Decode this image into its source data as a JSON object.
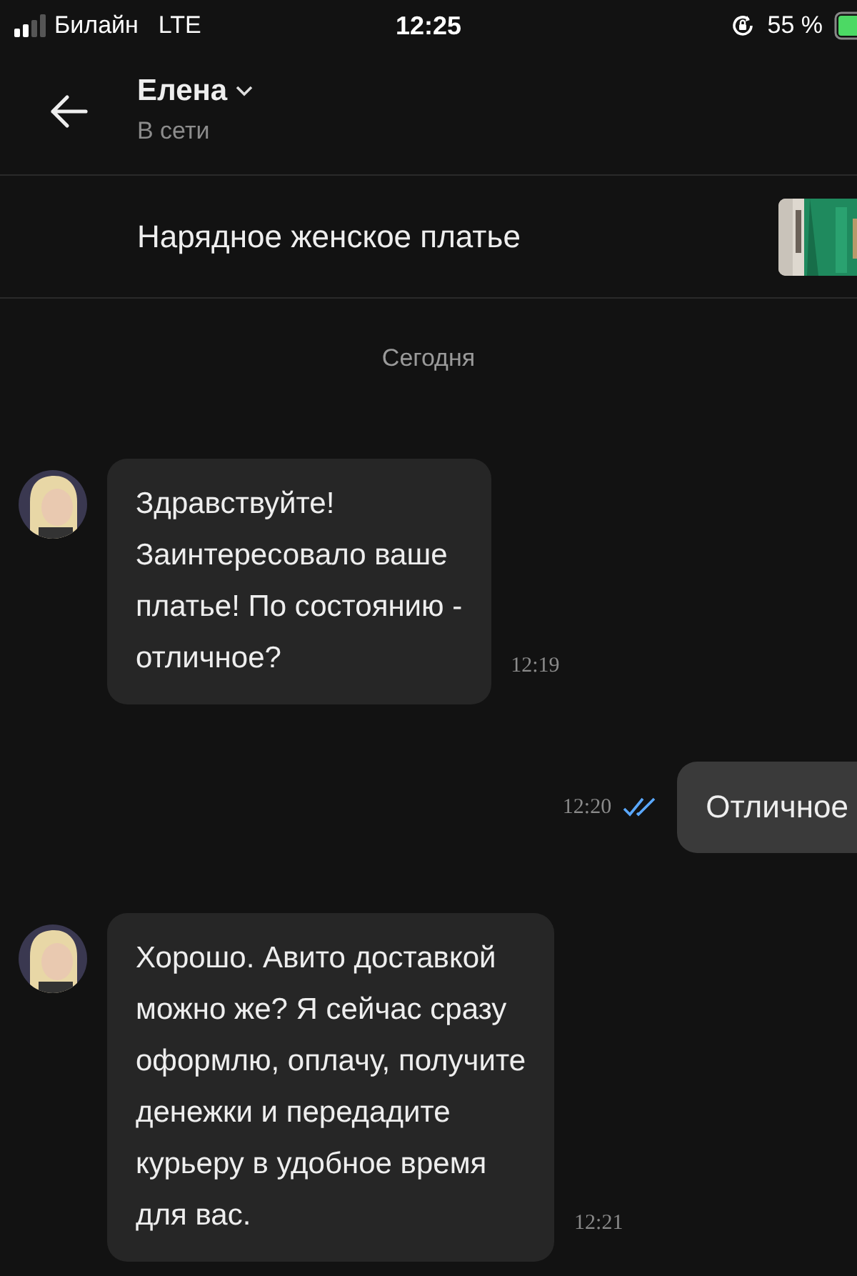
{
  "status_bar": {
    "carrier": "Билайн",
    "network": "LTE",
    "time": "12:25",
    "battery": "55 %"
  },
  "header": {
    "name": "Елена",
    "presence": "В сети"
  },
  "listing": {
    "title": "Нарядное женское платье"
  },
  "date_divider": "Сегодня",
  "messages": [
    {
      "kind": "incoming",
      "lines": [
        "Здравствуйте!",
        "Заинтересовало ваше",
        "платье! По состоянию -",
        "отличное?"
      ],
      "time": "12:19"
    },
    {
      "kind": "outgoing",
      "lines": [
        "Отличное"
      ],
      "time": "12:20",
      "read": true
    },
    {
      "kind": "incoming",
      "lines": [
        "Хорошо. Авито доставкой",
        "можно же? Я сейчас сразу",
        "оформлю, оплачу, получите",
        "денежки и передадите",
        "курьеру в удобное время",
        "для вас."
      ],
      "time": "12:21"
    }
  ]
}
